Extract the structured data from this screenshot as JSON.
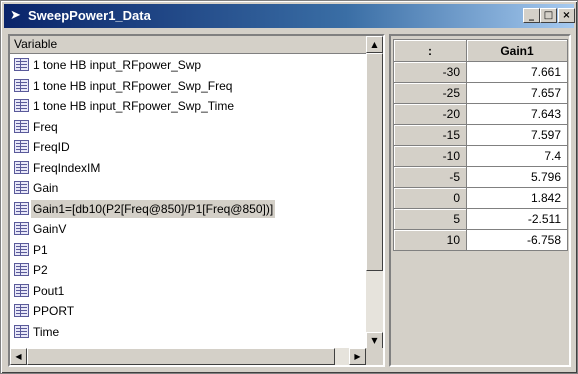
{
  "window": {
    "title": "SweepPower1_Data",
    "minimize_label": "_",
    "maximize_label": "□",
    "close_label": "×"
  },
  "variables": {
    "header": "Variable",
    "selected_index": 8,
    "items": [
      {
        "label": "1 tone HB input_RFpower_Swp",
        "icon": "table-icon"
      },
      {
        "label": "1 tone HB input_RFpower_Swp_Freq",
        "icon": "table-icon"
      },
      {
        "label": "1 tone HB input_RFpower_Swp_Time",
        "icon": "table-icon"
      },
      {
        "label": "Freq",
        "icon": "table-icon"
      },
      {
        "label": "FreqID",
        "icon": "table-icon"
      },
      {
        "label": "FreqIndexIM",
        "icon": "table-icon"
      },
      {
        "label": "Gain",
        "icon": "table-icon"
      },
      {
        "label": "Gain1=[db10(P2[Freq@850]/P1[Freq@850])]",
        "icon": "table-icon"
      },
      {
        "label": "GainV",
        "icon": "table-icon"
      },
      {
        "label": "P1",
        "icon": "table-icon"
      },
      {
        "label": "P2",
        "icon": "table-icon"
      },
      {
        "label": "Pout1",
        "icon": "table-icon"
      },
      {
        "label": "PPORT",
        "icon": "table-icon"
      },
      {
        "label": "Time",
        "icon": "table-icon"
      }
    ]
  },
  "table": {
    "index_header": ":",
    "value_header": "Gain1",
    "rows": [
      {
        "index": "-30",
        "value": "7.661"
      },
      {
        "index": "-25",
        "value": "7.657"
      },
      {
        "index": "-20",
        "value": "7.643"
      },
      {
        "index": "-15",
        "value": "7.597"
      },
      {
        "index": "-10",
        "value": "7.4"
      },
      {
        "index": "-5",
        "value": "5.796"
      },
      {
        "index": "0",
        "value": "1.842"
      },
      {
        "index": "5",
        "value": "-2.511"
      },
      {
        "index": "10",
        "value": "-6.758"
      }
    ]
  }
}
